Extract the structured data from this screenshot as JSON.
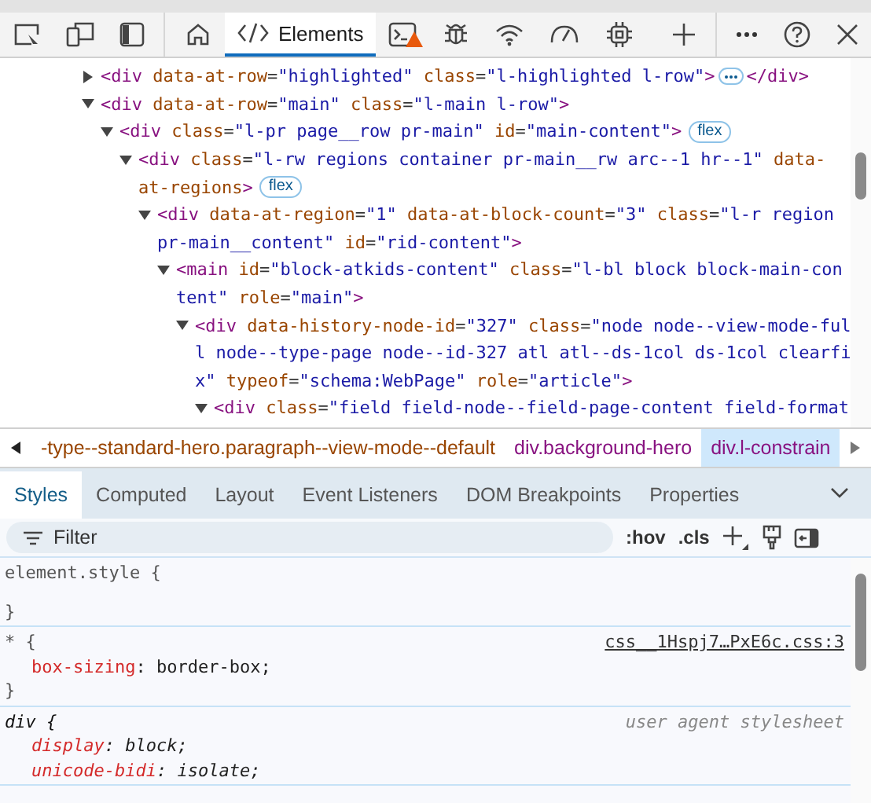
{
  "main_tabs": [
    {
      "kind": "icon",
      "selected": false
    },
    {
      "kind": "label",
      "label": "Elements",
      "selected": true
    },
    {
      "kind": "icon",
      "selected": false,
      "warning": true
    },
    {
      "kind": "icon",
      "selected": false
    },
    {
      "kind": "icon",
      "selected": false
    },
    {
      "kind": "icon",
      "selected": false
    },
    {
      "kind": "icon",
      "selected": false
    }
  ],
  "dom_tree": [
    {
      "expanded": false,
      "ellipsis": true,
      "closing": "</div>",
      "lines": [
        [
          {
            "kind": "tag",
            "text": "<div"
          },
          {
            "kind": "attr",
            "text": " data-at-row"
          },
          {
            "kind": "punct",
            "text": "="
          },
          {
            "kind": "value",
            "text": "\"highlighted\""
          },
          {
            "kind": "attr",
            "text": " class"
          },
          {
            "kind": "punct",
            "text": "="
          },
          {
            "kind": "value",
            "text": "\"l-highlighted l-row\""
          },
          {
            "kind": "tag",
            "text": ">"
          }
        ]
      ]
    },
    {
      "expanded": true,
      "lines": [
        [
          {
            "kind": "tag",
            "text": "<div"
          },
          {
            "kind": "attr",
            "text": " data-at-row"
          },
          {
            "kind": "punct",
            "text": "="
          },
          {
            "kind": "value",
            "text": "\"main\""
          },
          {
            "kind": "attr",
            "text": " class"
          },
          {
            "kind": "punct",
            "text": "="
          },
          {
            "kind": "value",
            "text": "\"l-main l-row\""
          },
          {
            "kind": "tag",
            "text": ">"
          }
        ]
      ],
      "children": [
        {
          "expanded": true,
          "badge": "flex",
          "lines": [
            [
              {
                "kind": "tag",
                "text": "<div"
              },
              {
                "kind": "attr",
                "text": " class"
              },
              {
                "kind": "punct",
                "text": "="
              },
              {
                "kind": "value",
                "text": "\"l-pr page__row pr-main\""
              },
              {
                "kind": "attr",
                "text": " id"
              },
              {
                "kind": "punct",
                "text": "="
              },
              {
                "kind": "value",
                "text": "\"main-content\""
              },
              {
                "kind": "tag",
                "text": ">"
              }
            ]
          ],
          "children": [
            {
              "expanded": true,
              "badge": "flex",
              "lines": [
                [
                  {
                    "kind": "tag",
                    "text": "<div"
                  },
                  {
                    "kind": "attr",
                    "text": " class"
                  },
                  {
                    "kind": "punct",
                    "text": "="
                  },
                  {
                    "kind": "value",
                    "text": "\"l-rw regions container pr-main__rw arc--1 hr--1\""
                  },
                  {
                    "kind": "attr",
                    "text": " data-"
                  }
                ],
                [
                  {
                    "kind": "attr",
                    "text": "at-regions"
                  },
                  {
                    "kind": "tag",
                    "text": ">"
                  }
                ]
              ],
              "children": [
                {
                  "expanded": true,
                  "lines": [
                    [
                      {
                        "kind": "tag",
                        "text": "<div"
                      },
                      {
                        "kind": "attr",
                        "text": " data-at-region"
                      },
                      {
                        "kind": "punct",
                        "text": "="
                      },
                      {
                        "kind": "value",
                        "text": "\"1\""
                      },
                      {
                        "kind": "attr",
                        "text": " data-at-block-count"
                      },
                      {
                        "kind": "punct",
                        "text": "="
                      },
                      {
                        "kind": "value",
                        "text": "\"3\""
                      },
                      {
                        "kind": "attr",
                        "text": " class"
                      },
                      {
                        "kind": "punct",
                        "text": "="
                      },
                      {
                        "kind": "value",
                        "text": "\"l-r region"
                      }
                    ],
                    [
                      {
                        "kind": "value",
                        "text": "pr-main__content\""
                      },
                      {
                        "kind": "attr",
                        "text": " id"
                      },
                      {
                        "kind": "punct",
                        "text": "="
                      },
                      {
                        "kind": "value",
                        "text": "\"rid-content\""
                      },
                      {
                        "kind": "tag",
                        "text": ">"
                      }
                    ]
                  ],
                  "children": [
                    {
                      "expanded": true,
                      "lines": [
                        [
                          {
                            "kind": "tag",
                            "text": "<main"
                          },
                          {
                            "kind": "attr",
                            "text": " id"
                          },
                          {
                            "kind": "punct",
                            "text": "="
                          },
                          {
                            "kind": "value",
                            "text": "\"block-atkids-content\""
                          },
                          {
                            "kind": "attr",
                            "text": " class"
                          },
                          {
                            "kind": "punct",
                            "text": "="
                          },
                          {
                            "kind": "value",
                            "text": "\"l-bl block block-main-con"
                          }
                        ],
                        [
                          {
                            "kind": "value",
                            "text": "tent\""
                          },
                          {
                            "kind": "attr",
                            "text": " role"
                          },
                          {
                            "kind": "punct",
                            "text": "="
                          },
                          {
                            "kind": "value",
                            "text": "\"main\""
                          },
                          {
                            "kind": "tag",
                            "text": ">"
                          }
                        ]
                      ],
                      "children": [
                        {
                          "expanded": true,
                          "lines": [
                            [
                              {
                                "kind": "tag",
                                "text": "<div"
                              },
                              {
                                "kind": "attr",
                                "text": " data-history-node-id"
                              },
                              {
                                "kind": "punct",
                                "text": "="
                              },
                              {
                                "kind": "value",
                                "text": "\"327\""
                              },
                              {
                                "kind": "attr",
                                "text": " class"
                              },
                              {
                                "kind": "punct",
                                "text": "="
                              },
                              {
                                "kind": "value",
                                "text": "\"node node--view-mode-ful"
                              }
                            ],
                            [
                              {
                                "kind": "value",
                                "text": "l node--type-page node--id-327 atl atl--ds-1col ds-1col clearfi"
                              }
                            ],
                            [
                              {
                                "kind": "value",
                                "text": "x\""
                              },
                              {
                                "kind": "attr",
                                "text": " typeof"
                              },
                              {
                                "kind": "punct",
                                "text": "="
                              },
                              {
                                "kind": "value",
                                "text": "\"schema:WebPage\""
                              },
                              {
                                "kind": "attr",
                                "text": " role"
                              },
                              {
                                "kind": "punct",
                                "text": "="
                              },
                              {
                                "kind": "value",
                                "text": "\"article\""
                              },
                              {
                                "kind": "tag",
                                "text": ">"
                              }
                            ]
                          ],
                          "children": [
                            {
                              "expanded": true,
                              "lines": [
                                [
                                  {
                                    "kind": "tag",
                                    "text": "<div"
                                  },
                                  {
                                    "kind": "attr",
                                    "text": " class"
                                  },
                                  {
                                    "kind": "punct",
                                    "text": "="
                                  },
                                  {
                                    "kind": "value",
                                    "text": "\"field field-node--field-page-content field-format"
                                  }
                                ]
                              ]
                            }
                          ]
                        }
                      ]
                    }
                  ]
                }
              ]
            }
          ]
        }
      ]
    }
  ],
  "breadcrumbs": [
    {
      "label": "-type--standard-hero.paragraph--view-mode--default",
      "kind": "class",
      "selected": false
    },
    {
      "label": "div.background-hero",
      "kind": "element",
      "selected": false
    },
    {
      "label": "div.l-constrain",
      "kind": "element",
      "selected": true
    }
  ],
  "sub_tabs": [
    {
      "label": "Styles",
      "selected": true
    },
    {
      "label": "Computed",
      "selected": false
    },
    {
      "label": "Layout",
      "selected": false
    },
    {
      "label": "Event Listeners",
      "selected": false
    },
    {
      "label": "DOM Breakpoints",
      "selected": false
    },
    {
      "label": "Properties",
      "selected": false
    }
  ],
  "filter": {
    "placeholder": "Filter"
  },
  "style_buttons": [
    ":hov",
    ".cls"
  ],
  "rules": [
    {
      "kind": "inline",
      "selector": "element.style {",
      "close": "}"
    },
    {
      "kind": "author",
      "selector": "* {",
      "source": "css__1Hspj7…PxE6c.css:3",
      "declarations": [
        {
          "property": "box-sizing",
          "rest": ": border-box;"
        }
      ],
      "close": "}"
    },
    {
      "kind": "user_agent",
      "selector": "div {",
      "source": "user agent stylesheet",
      "declarations": [
        {
          "property": "display",
          "rest": ": block;"
        },
        {
          "property": "unicode-bidi",
          "rest": ": isolate;"
        }
      ]
    }
  ]
}
